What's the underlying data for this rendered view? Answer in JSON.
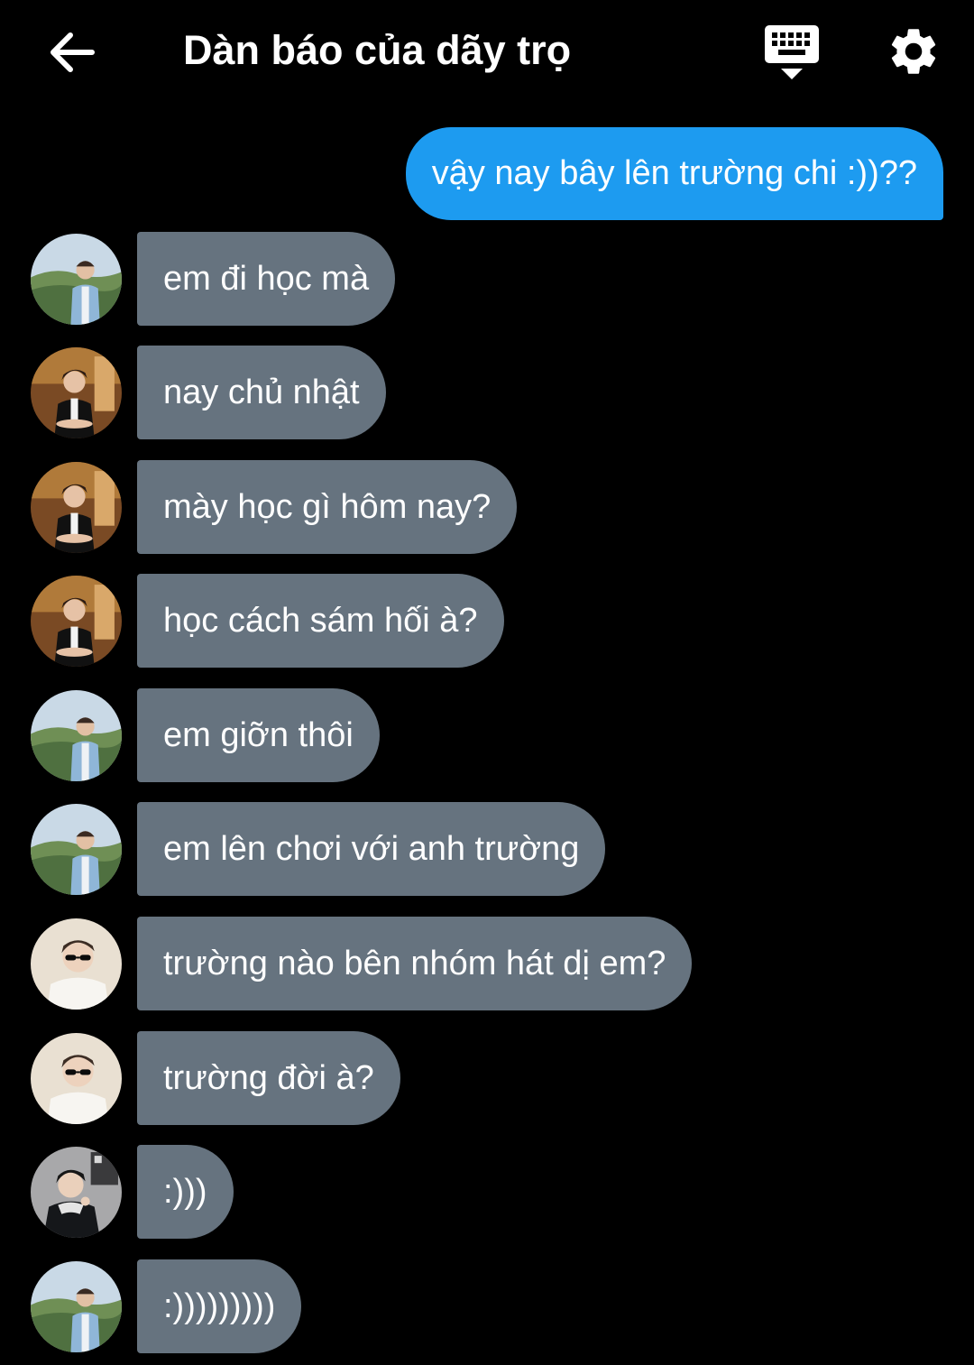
{
  "header": {
    "title": "Dàn báo của dãy trọ",
    "back_icon": "arrow-left-icon",
    "keyboard_icon": "keyboard-hide-icon",
    "settings_icon": "gear-icon"
  },
  "colors": {
    "background": "#000000",
    "outgoing_bubble": "#1d9bf0",
    "incoming_bubble": "#66737f",
    "text": "#ffffff"
  },
  "messages": {
    "outgoing": {
      "text": "vậy nay bây lên trường chi :))??"
    },
    "incoming": [
      {
        "text": "em đi học mà",
        "avatar": "avatar-green-hills"
      },
      {
        "text": "nay chủ nhật",
        "avatar": "avatar-warm-room"
      },
      {
        "text": "mày học gì hôm nay?",
        "avatar": "avatar-warm-room"
      },
      {
        "text": "học cách sám hối à?",
        "avatar": "avatar-warm-room"
      },
      {
        "text": "em giỡn thôi",
        "avatar": "avatar-green-hills"
      },
      {
        "text": "em lên chơi với anh trường",
        "avatar": "avatar-green-hills"
      },
      {
        "text": "trường nào bên nhóm hát dị em?",
        "avatar": "avatar-sunglasses"
      },
      {
        "text": "trường đời à?",
        "avatar": "avatar-sunglasses"
      },
      {
        "text": ":)))",
        "avatar": "avatar-dark-jacket"
      },
      {
        "text": ":)))))))))",
        "avatar": "avatar-green-hills"
      }
    ]
  }
}
